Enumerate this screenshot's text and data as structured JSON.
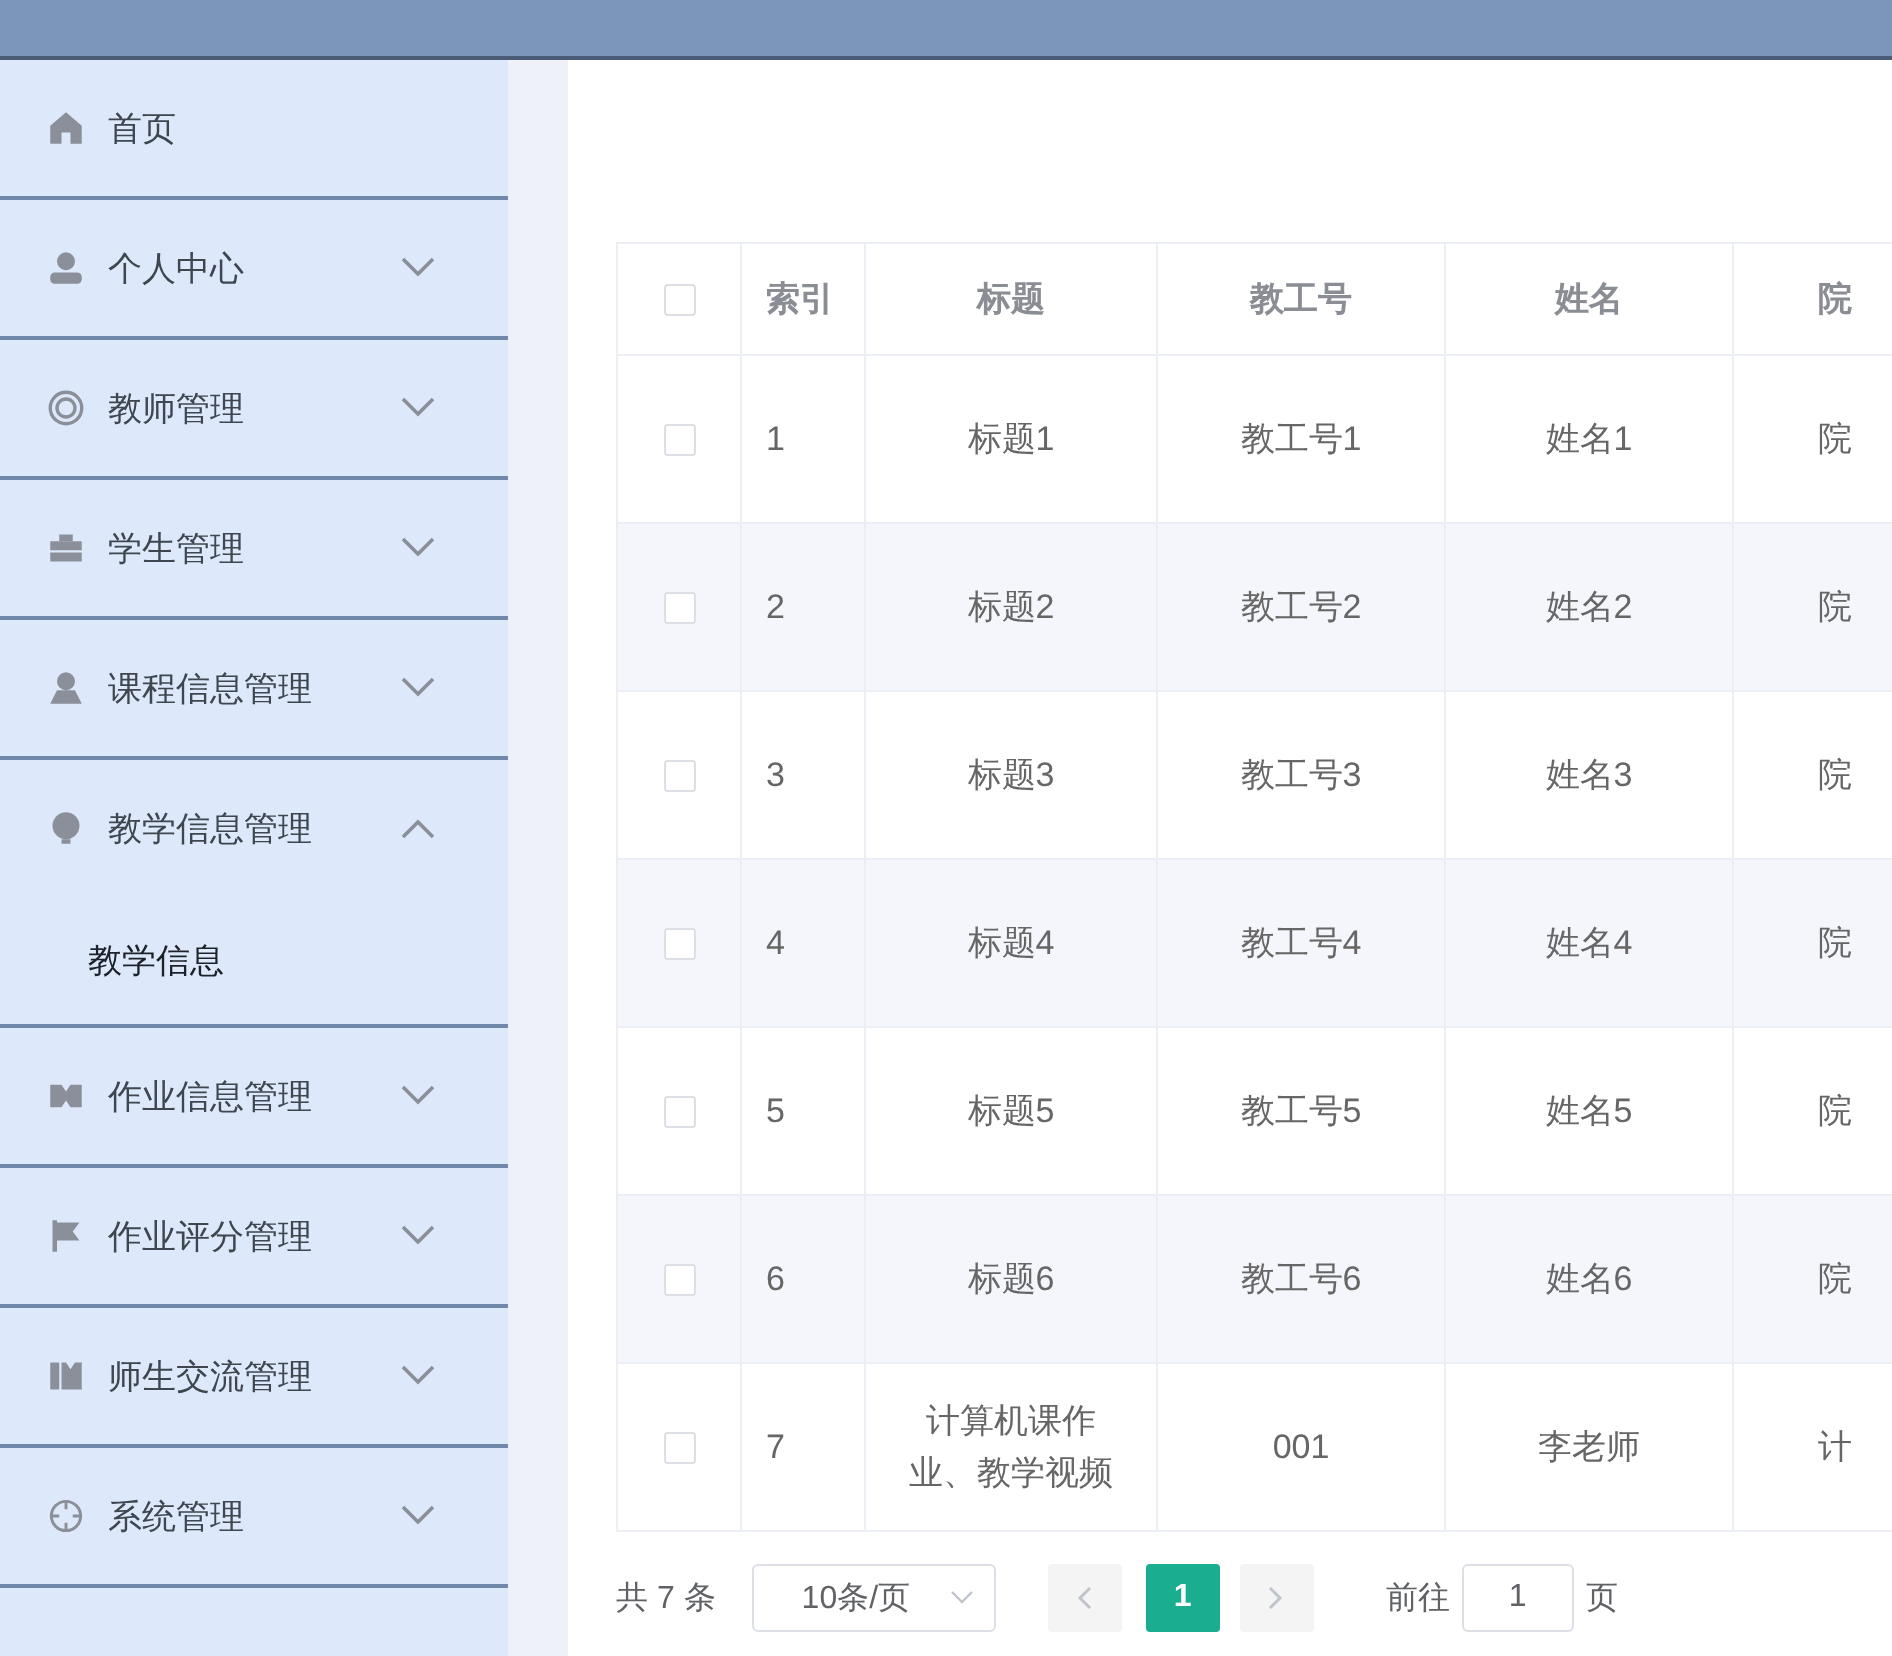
{
  "sidebar": {
    "items": [
      {
        "label": "首页",
        "kind": "link"
      },
      {
        "label": "个人中心",
        "kind": "menu",
        "expanded": false
      },
      {
        "label": "教师管理",
        "kind": "menu",
        "expanded": false
      },
      {
        "label": "学生管理",
        "kind": "menu",
        "expanded": false
      },
      {
        "label": "课程信息管理",
        "kind": "menu",
        "expanded": false
      },
      {
        "label": "教学信息管理",
        "kind": "menu",
        "expanded": true,
        "children": [
          {
            "label": "教学信息",
            "selected": true
          }
        ]
      },
      {
        "label": "作业信息管理",
        "kind": "menu",
        "expanded": false
      },
      {
        "label": "作业评分管理",
        "kind": "menu",
        "expanded": false
      },
      {
        "label": "师生交流管理",
        "kind": "menu",
        "expanded": false
      },
      {
        "label": "系统管理",
        "kind": "menu",
        "expanded": false
      }
    ]
  },
  "table": {
    "select_all_checked": false,
    "columns": [
      "索引",
      "标题",
      "教工号",
      "姓名",
      "院"
    ],
    "rows": [
      {
        "checked": false,
        "cells": [
          "1",
          "标题1",
          "教工号1",
          "姓名1",
          "院"
        ]
      },
      {
        "checked": false,
        "cells": [
          "2",
          "标题2",
          "教工号2",
          "姓名2",
          "院"
        ]
      },
      {
        "checked": false,
        "cells": [
          "3",
          "标题3",
          "教工号3",
          "姓名3",
          "院"
        ]
      },
      {
        "checked": false,
        "cells": [
          "4",
          "标题4",
          "教工号4",
          "姓名4",
          "院"
        ]
      },
      {
        "checked": false,
        "cells": [
          "5",
          "标题5",
          "教工号5",
          "姓名5",
          "院"
        ]
      },
      {
        "checked": false,
        "cells": [
          "6",
          "标题6",
          "教工号6",
          "姓名6",
          "院"
        ]
      },
      {
        "checked": false,
        "cells": [
          "7",
          "计算机课作业、教学视频",
          "001",
          "李老师",
          "计"
        ]
      }
    ]
  },
  "pagination": {
    "total": "共 7 条",
    "page_size": "10条/页",
    "pages": [
      {
        "label": "1",
        "selected": true
      }
    ],
    "goto_label": "前往",
    "goto_value": "1",
    "goto_suffix": "页"
  }
}
